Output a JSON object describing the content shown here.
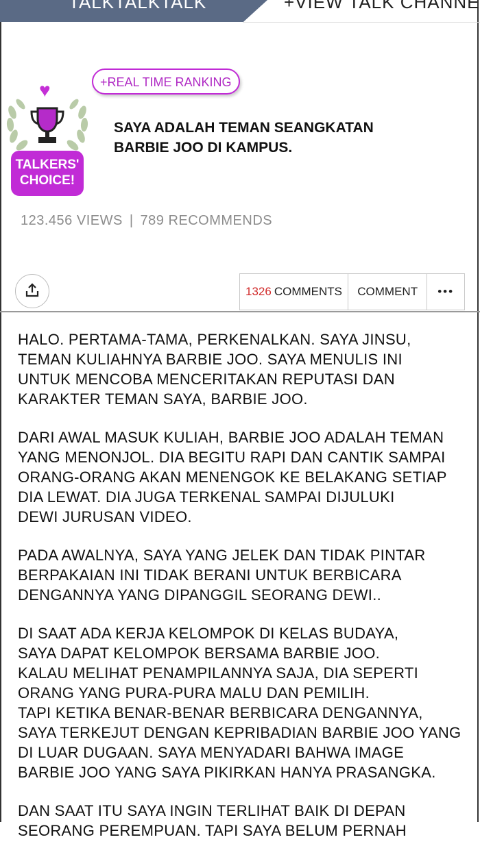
{
  "tabs": {
    "active_label": "TALKTALKTALK",
    "channel_link": "+VIEW TALK CHANNEL"
  },
  "badge": {
    "icon": "trophy-icon",
    "label_line1": "TALKERS'",
    "label_line2": "CHOICE!",
    "color": "#c12bd6"
  },
  "ranking_pill": "+REAL TIME RANKING",
  "post": {
    "title_line1": "SAYA ADALAH TEMAN SEANGKATAN",
    "title_line2": "BARBIE JOO DI KAMPUS.",
    "views": "123.456 VIEWS",
    "separator": "|",
    "recommends": "789 RECOMMENDS"
  },
  "actions": {
    "comment_count": "1326",
    "comments_label": "COMMENTS",
    "comment_label": "COMMENT",
    "more_label": "•••"
  },
  "body": {
    "paragraphs": [
      "HALO. PERTAMA-TAMA, PERKENALKAN. SAYA JINSU,\nTEMAN KULIAHNYA BARBIE JOO. SAYA MENULIS INI\nUNTUK MENCOBA MENCERITAKAN REPUTASI DAN\nKARAKTER TEMAN SAYA, BARBIE JOO.",
      "DARI AWAL MASUK KULIAH, BARBIE JOO ADALAH TEMAN\nYANG MENONJOL. DIA BEGITU RAPI DAN CANTIK SAMPAI\nORANG-ORANG AKAN MENENGOK KE BELAKANG SETIAP\nDIA LEWAT. DIA JUGA TERKENAL SAMPAI DIJULUKI\nDEWI JURUSAN VIDEO.",
      "PADA AWALNYA, SAYA YANG JELEK DAN TIDAK PINTAR\nBERPAKAIAN INI TIDAK BERANI UNTUK BERBICARA\nDENGANNYA YANG DIPANGGIL SEORANG DEWI..",
      "DI SAAT ADA KERJA KELOMPOK DI KELAS BUDAYA,\nSAYA DAPAT KELOMPOK BERSAMA BARBIE JOO.\nKALAU MELIHAT PENAMPILANNYA SAJA, DIA SEPERTI\nORANG YANG PURA-PURA MALU DAN PEMILIH.\nTAPI KETIKA BENAR-BENAR BERBICARA DENGANNYA,\nSAYA TERKEJUT DENGAN KEPRIBADIAN BARBIE JOO YANG\nDI LUAR DUGAAN. SAYA MENYADARI BAHWA IMAGE\nBARBIE JOO YANG SAYA PIKIRKAN HANYA PRASANGKA.",
      "DAN SAAT ITU SAYA INGIN TERLIHAT BAIK DI DEPAN\nSEORANG PEREMPUAN. TAPI SAYA BELUM PERNAH"
    ]
  }
}
